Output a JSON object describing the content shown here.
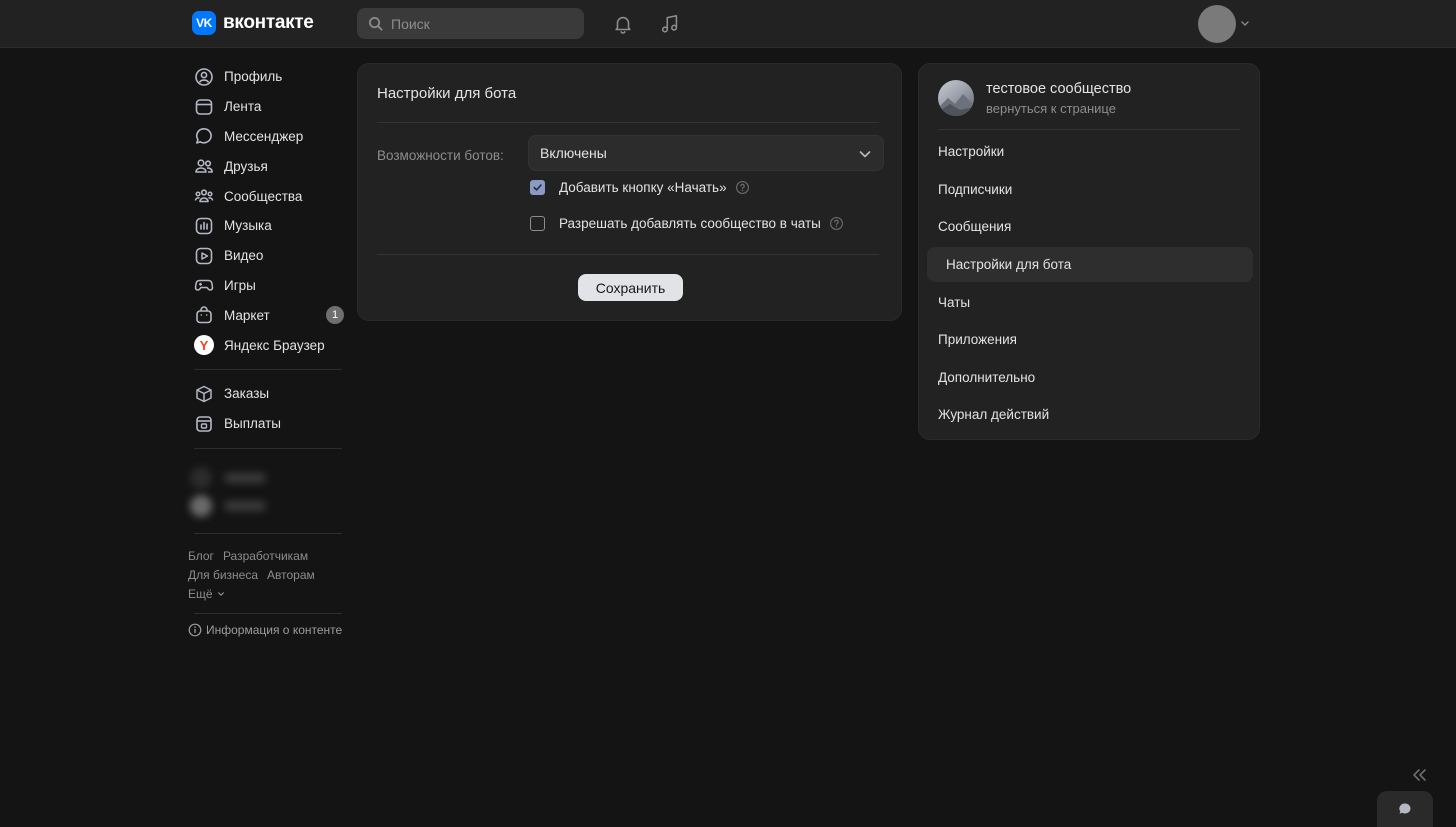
{
  "header": {
    "logo_mark": "VK",
    "logo_text": "вконтакте",
    "search_placeholder": "Поиск"
  },
  "leftnav": {
    "items": [
      {
        "label": "Профиль",
        "icon": "user-circle-icon"
      },
      {
        "label": "Лента",
        "icon": "newsfeed-icon"
      },
      {
        "label": "Мессенджер",
        "icon": "message-icon"
      },
      {
        "label": "Друзья",
        "icon": "friends-icon"
      },
      {
        "label": "Сообщества",
        "icon": "communities-icon"
      },
      {
        "label": "Музыка",
        "icon": "music-icon"
      },
      {
        "label": "Видео",
        "icon": "video-icon"
      },
      {
        "label": "Игры",
        "icon": "gamepad-icon"
      },
      {
        "label": "Маркет",
        "icon": "bag-icon",
        "badge": "1"
      },
      {
        "label": "Яндекс Браузер",
        "icon": "yandex-icon",
        "icon_glyph": "Y"
      }
    ],
    "secondary": [
      {
        "label": "Заказы",
        "icon": "box-icon"
      },
      {
        "label": "Выплаты",
        "icon": "payout-icon"
      }
    ],
    "footer": {
      "links_row1": [
        "Блог",
        "Разработчикам"
      ],
      "links_row2": [
        "Для бизнеса",
        "Авторам"
      ],
      "more": "Ещё",
      "info": "Информация о контенте"
    }
  },
  "main": {
    "title": "Настройки для бота",
    "bot_caps_label": "Возможности ботов:",
    "bot_caps_value": "Включены",
    "checkbox_start": {
      "label": "Добавить кнопку «Начать»",
      "checked": true
    },
    "checkbox_chats": {
      "label": "Разрешать добавлять сообщество в чаты",
      "checked": false
    },
    "save_label": "Сохранить"
  },
  "right": {
    "community_name": "тестовое сообщество",
    "back_link": "вернуться к странице",
    "menu": [
      "Настройки",
      "Подписчики",
      "Сообщения",
      "Настройки для бота",
      "Чаты",
      "Приложения",
      "Дополнительно",
      "Журнал действий"
    ],
    "active_index": 3
  },
  "colors": {
    "background": "#141414",
    "panel": "#222222",
    "accent": "#0077ff",
    "checkbox": "#8a9ac4"
  }
}
